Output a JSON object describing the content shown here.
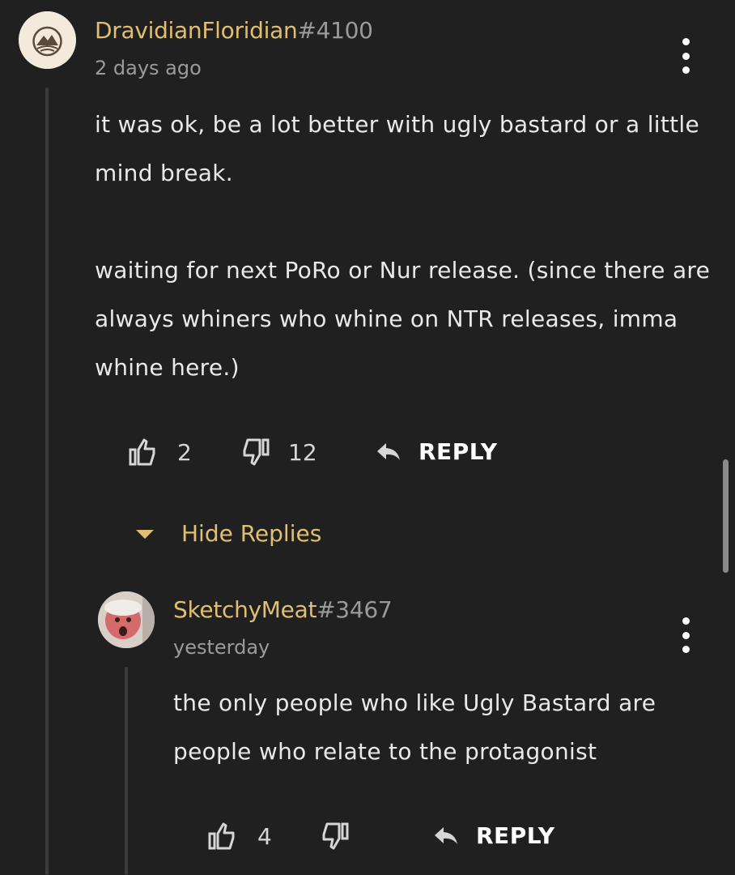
{
  "comments": [
    {
      "username": "DravidianFloridian",
      "tag": "#4100",
      "time": "2 days ago",
      "body": [
        "it was ok, be a lot better with ugly bastard or a little mind break.",
        "waiting for next PoRo or Nur release. (since there are always whiners who whine on NTR releases, imma whine here.)"
      ],
      "likes": "2",
      "dislikes": "12",
      "reply_label": "REPLY",
      "toggle_replies_label": "Hide Replies"
    },
    {
      "username": "SketchyMeat",
      "tag": "#3467",
      "time": "yesterday",
      "body": [
        "the only people who like Ugly Bastard are people who relate to the protagonist"
      ],
      "likes": "4",
      "dislikes": "",
      "reply_label": "REPLY"
    }
  ],
  "colors": {
    "background": "#202020",
    "username": "#e0bf72",
    "tag": "#9a9a9a",
    "muted": "#9b9b9b",
    "text": "#e9e9e9"
  },
  "icons": [
    "mountain-avatar-icon",
    "kebab-menu-icon",
    "thumbs-up-icon",
    "thumbs-down-icon",
    "reply-arrow-icon",
    "caret-down-icon"
  ]
}
